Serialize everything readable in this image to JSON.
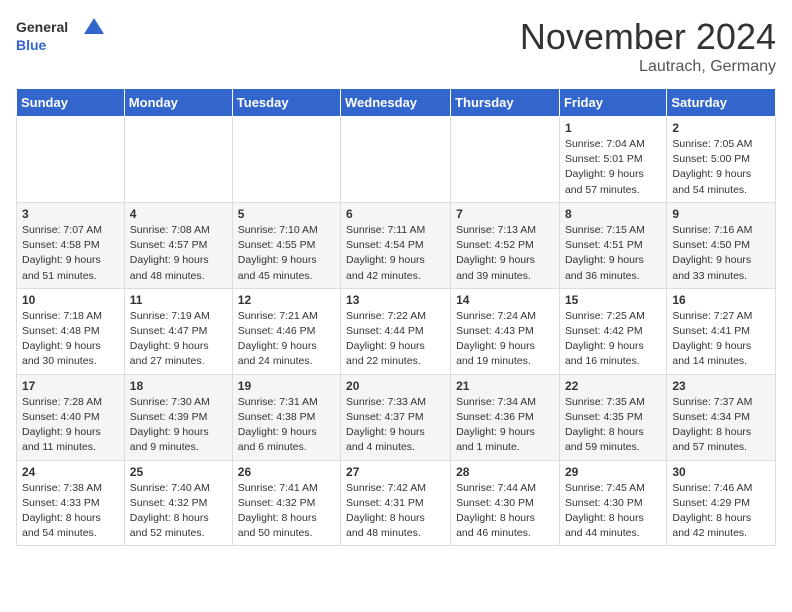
{
  "logo": {
    "line1": "General",
    "line2": "Blue"
  },
  "title": "November 2024",
  "location": "Lautrach, Germany",
  "days_of_week": [
    "Sunday",
    "Monday",
    "Tuesday",
    "Wednesday",
    "Thursday",
    "Friday",
    "Saturday"
  ],
  "weeks": [
    [
      {
        "day": "",
        "info": ""
      },
      {
        "day": "",
        "info": ""
      },
      {
        "day": "",
        "info": ""
      },
      {
        "day": "",
        "info": ""
      },
      {
        "day": "",
        "info": ""
      },
      {
        "day": "1",
        "info": "Sunrise: 7:04 AM\nSunset: 5:01 PM\nDaylight: 9 hours and 57 minutes."
      },
      {
        "day": "2",
        "info": "Sunrise: 7:05 AM\nSunset: 5:00 PM\nDaylight: 9 hours and 54 minutes."
      }
    ],
    [
      {
        "day": "3",
        "info": "Sunrise: 7:07 AM\nSunset: 4:58 PM\nDaylight: 9 hours and 51 minutes."
      },
      {
        "day": "4",
        "info": "Sunrise: 7:08 AM\nSunset: 4:57 PM\nDaylight: 9 hours and 48 minutes."
      },
      {
        "day": "5",
        "info": "Sunrise: 7:10 AM\nSunset: 4:55 PM\nDaylight: 9 hours and 45 minutes."
      },
      {
        "day": "6",
        "info": "Sunrise: 7:11 AM\nSunset: 4:54 PM\nDaylight: 9 hours and 42 minutes."
      },
      {
        "day": "7",
        "info": "Sunrise: 7:13 AM\nSunset: 4:52 PM\nDaylight: 9 hours and 39 minutes."
      },
      {
        "day": "8",
        "info": "Sunrise: 7:15 AM\nSunset: 4:51 PM\nDaylight: 9 hours and 36 minutes."
      },
      {
        "day": "9",
        "info": "Sunrise: 7:16 AM\nSunset: 4:50 PM\nDaylight: 9 hours and 33 minutes."
      }
    ],
    [
      {
        "day": "10",
        "info": "Sunrise: 7:18 AM\nSunset: 4:48 PM\nDaylight: 9 hours and 30 minutes."
      },
      {
        "day": "11",
        "info": "Sunrise: 7:19 AM\nSunset: 4:47 PM\nDaylight: 9 hours and 27 minutes."
      },
      {
        "day": "12",
        "info": "Sunrise: 7:21 AM\nSunset: 4:46 PM\nDaylight: 9 hours and 24 minutes."
      },
      {
        "day": "13",
        "info": "Sunrise: 7:22 AM\nSunset: 4:44 PM\nDaylight: 9 hours and 22 minutes."
      },
      {
        "day": "14",
        "info": "Sunrise: 7:24 AM\nSunset: 4:43 PM\nDaylight: 9 hours and 19 minutes."
      },
      {
        "day": "15",
        "info": "Sunrise: 7:25 AM\nSunset: 4:42 PM\nDaylight: 9 hours and 16 minutes."
      },
      {
        "day": "16",
        "info": "Sunrise: 7:27 AM\nSunset: 4:41 PM\nDaylight: 9 hours and 14 minutes."
      }
    ],
    [
      {
        "day": "17",
        "info": "Sunrise: 7:28 AM\nSunset: 4:40 PM\nDaylight: 9 hours and 11 minutes."
      },
      {
        "day": "18",
        "info": "Sunrise: 7:30 AM\nSunset: 4:39 PM\nDaylight: 9 hours and 9 minutes."
      },
      {
        "day": "19",
        "info": "Sunrise: 7:31 AM\nSunset: 4:38 PM\nDaylight: 9 hours and 6 minutes."
      },
      {
        "day": "20",
        "info": "Sunrise: 7:33 AM\nSunset: 4:37 PM\nDaylight: 9 hours and 4 minutes."
      },
      {
        "day": "21",
        "info": "Sunrise: 7:34 AM\nSunset: 4:36 PM\nDaylight: 9 hours and 1 minute."
      },
      {
        "day": "22",
        "info": "Sunrise: 7:35 AM\nSunset: 4:35 PM\nDaylight: 8 hours and 59 minutes."
      },
      {
        "day": "23",
        "info": "Sunrise: 7:37 AM\nSunset: 4:34 PM\nDaylight: 8 hours and 57 minutes."
      }
    ],
    [
      {
        "day": "24",
        "info": "Sunrise: 7:38 AM\nSunset: 4:33 PM\nDaylight: 8 hours and 54 minutes."
      },
      {
        "day": "25",
        "info": "Sunrise: 7:40 AM\nSunset: 4:32 PM\nDaylight: 8 hours and 52 minutes."
      },
      {
        "day": "26",
        "info": "Sunrise: 7:41 AM\nSunset: 4:32 PM\nDaylight: 8 hours and 50 minutes."
      },
      {
        "day": "27",
        "info": "Sunrise: 7:42 AM\nSunset: 4:31 PM\nDaylight: 8 hours and 48 minutes."
      },
      {
        "day": "28",
        "info": "Sunrise: 7:44 AM\nSunset: 4:30 PM\nDaylight: 8 hours and 46 minutes."
      },
      {
        "day": "29",
        "info": "Sunrise: 7:45 AM\nSunset: 4:30 PM\nDaylight: 8 hours and 44 minutes."
      },
      {
        "day": "30",
        "info": "Sunrise: 7:46 AM\nSunset: 4:29 PM\nDaylight: 8 hours and 42 minutes."
      }
    ]
  ]
}
